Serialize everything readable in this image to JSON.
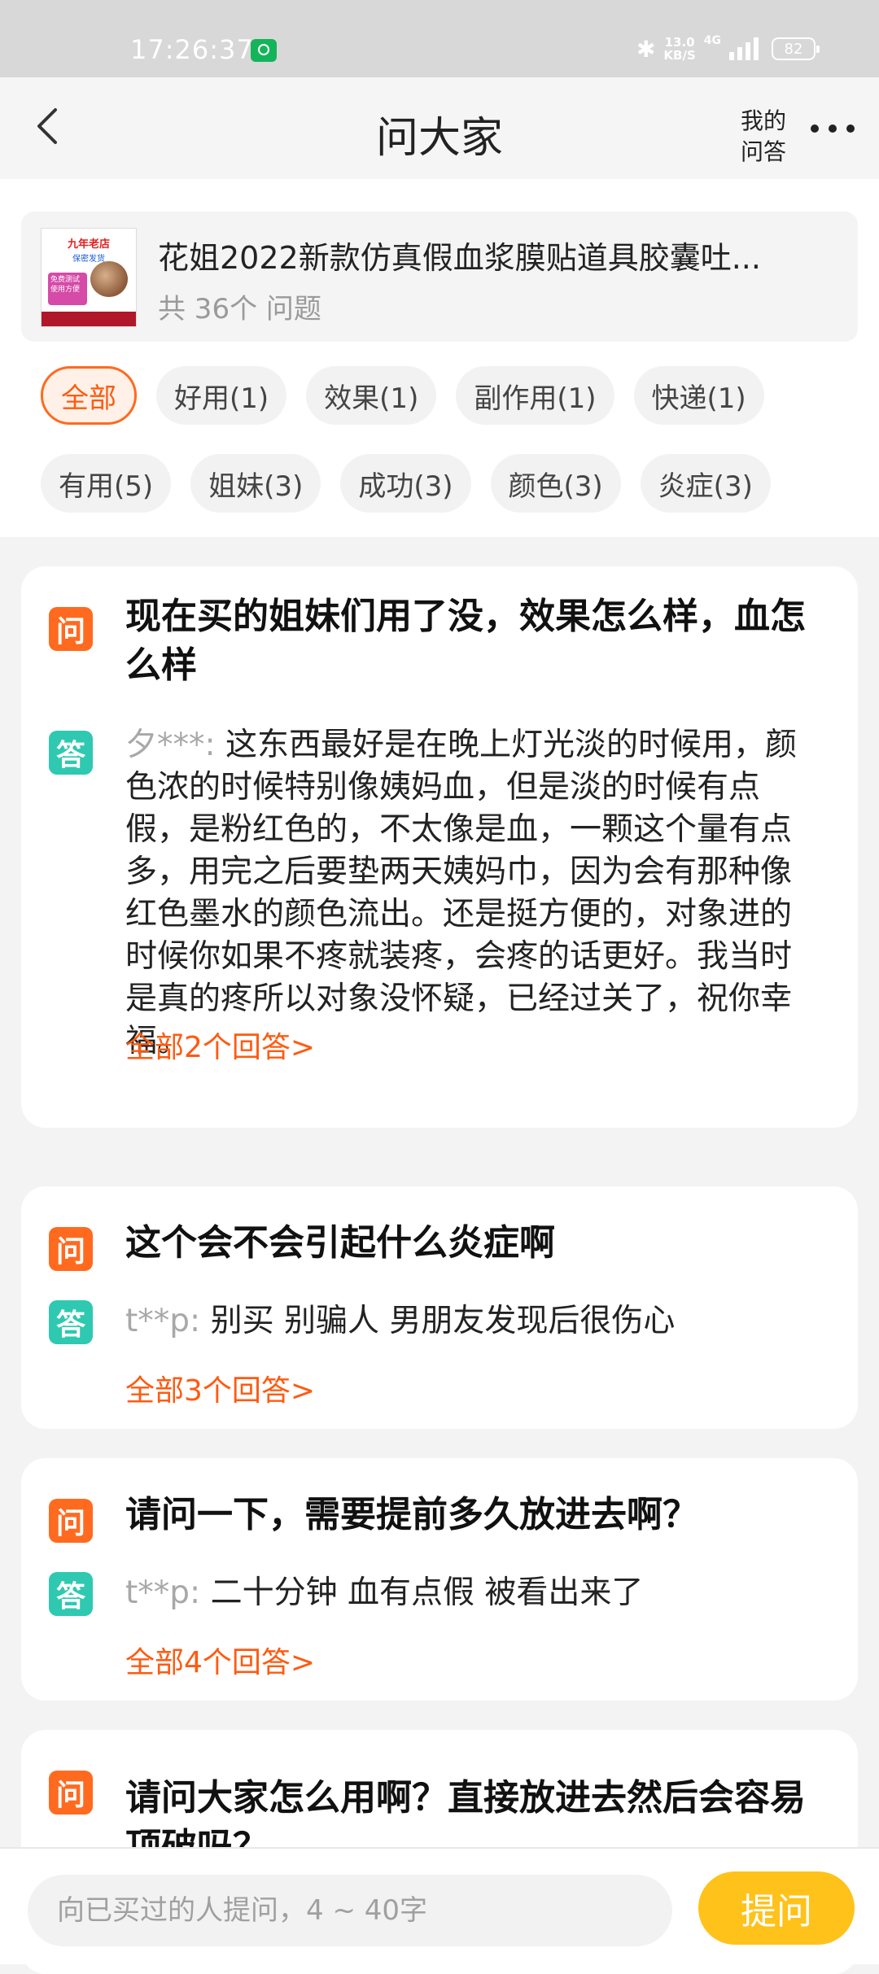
{
  "status_bar": {
    "time": "17:26:37",
    "net_speed_value": "13.0",
    "net_speed_unit": "KB/S",
    "network_type": "4G",
    "battery": "82"
  },
  "nav": {
    "title": "问大家",
    "my_answers_line1": "我的",
    "my_answers_line2": "问答"
  },
  "product": {
    "title": "花姐2022新款仿真假血浆膜贴道具胶囊吐...",
    "question_count": "共 36个 问题",
    "thumb_shop": "九年老店",
    "thumb_tagline": "保密发货",
    "thumb_badge": "免费测试 使用方便"
  },
  "tags": [
    {
      "label": "全部",
      "active": true
    },
    {
      "label": "好用(1)"
    },
    {
      "label": "效果(1)"
    },
    {
      "label": "副作用(1)"
    },
    {
      "label": "快递(1)"
    },
    {
      "label": "有用(5)"
    },
    {
      "label": "姐妹(3)"
    },
    {
      "label": "成功(3)"
    },
    {
      "label": "颜色(3)"
    },
    {
      "label": "炎症(3)"
    }
  ],
  "qa_icons": {
    "question": "问",
    "answer": "答"
  },
  "qa": [
    {
      "question": "现在买的姐妹们用了没，效果怎么样，血怎么样",
      "user": "夕***:",
      "answer": "这东西最好是在晚上灯光淡的时候用，颜色浓的时候特别像姨妈血，但是淡的时候有点假，是粉红色的，不太像是血，一颗这个量有点多，用完之后要垫两天姨妈巾，因为会有那种像红色墨水的颜色流出。还是挺方便的，对象进的时候你如果不疼就装疼，会疼的话更好。我当时是真的疼所以对象没怀疑，已经过关了，祝你幸福。",
      "more": "全部2个回答>"
    },
    {
      "question": "这个会不会引起什么炎症啊",
      "user": "t**p:",
      "answer": "别买 别骗人 男朋友发现后很伤心",
      "more": "全部3个回答>"
    },
    {
      "question": "请问一下，需要提前多久放进去啊？",
      "user": "t**p:",
      "answer": "二十分钟 血有点假 被看出来了",
      "more": "全部4个回答>"
    },
    {
      "question": "请问大家怎么用啊？直接放进去然后会容易顶破吗？"
    }
  ],
  "bottom": {
    "ask_placeholder": "向已买过的人提问，4 ~ 40字",
    "ask_button": "提问"
  }
}
